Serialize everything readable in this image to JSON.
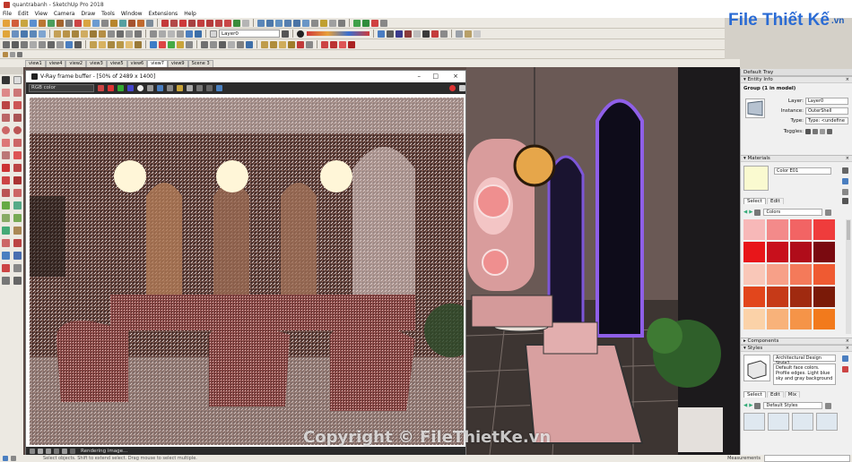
{
  "window": {
    "title": "quantrabanh - SketchUp Pro 2018"
  },
  "menu": [
    "File",
    "Edit",
    "View",
    "Camera",
    "Draw",
    "Tools",
    "Window",
    "Extensions",
    "Help"
  ],
  "layer_select": "Layer0",
  "shadow": {
    "months": "J F M A M J J A S O N D",
    "time_start": "06:43 AM",
    "noon": "Noon",
    "time_end": "04:45 PM"
  },
  "scenes": [
    "view1",
    "view4",
    "view2",
    "view3",
    "view5",
    "view6",
    "view7",
    "view9",
    "Scene 3"
  ],
  "active_scene": "view7",
  "vray": {
    "title": "V-Ray frame buffer - [50% of 2489 x 1400]",
    "channel": "RGB color",
    "status": "Rendering image..."
  },
  "tray": {
    "title": "Default Tray",
    "entity_info": {
      "header": "Entity Info",
      "name": "Group (1 in model)",
      "layer_label": "Layer:",
      "layer_value": "Layer0",
      "instance_label": "Instance:",
      "instance_value": "OuterShell",
      "type_label": "Type:",
      "type_value": "Type: <undefine",
      "toggles_label": "Toggles:"
    },
    "materials": {
      "header": "Materials",
      "color_name": "Color E01",
      "tab_select": "Select",
      "tab_edit": "Edit",
      "library": "Colors"
    },
    "components": {
      "header": "Components"
    },
    "styles": {
      "header": "Styles",
      "style_name": "Architectural Design Style1",
      "description": "Default face colors. Profile edges. Light blue sky and gray background",
      "tab_select": "Select",
      "tab_edit": "Edit",
      "tab_mix": "Mix",
      "library": "Default Styles"
    }
  },
  "swatches": [
    "#f7b8b8",
    "#f38a8a",
    "#f26464",
    "#ef3c3c",
    "#e8161a",
    "#c8101c",
    "#b00c1a",
    "#7a0a10",
    "#f9c7b8",
    "#f7a088",
    "#f47a5a",
    "#ef5a32",
    "#e2461c",
    "#c63a18",
    "#a02a10",
    "#7a1a08",
    "#fbd2a8",
    "#f8b27a",
    "#f59448",
    "#f27a1c"
  ],
  "status_bar": {
    "measurements_label": "Measurements",
    "hint": "Select objects. Shift to extend select. Drag mouse to select multiple."
  },
  "brand": {
    "name": "File Thiết Kế",
    "domain": ".vn"
  },
  "watermark": "Copyright © FileThietKe.vn"
}
